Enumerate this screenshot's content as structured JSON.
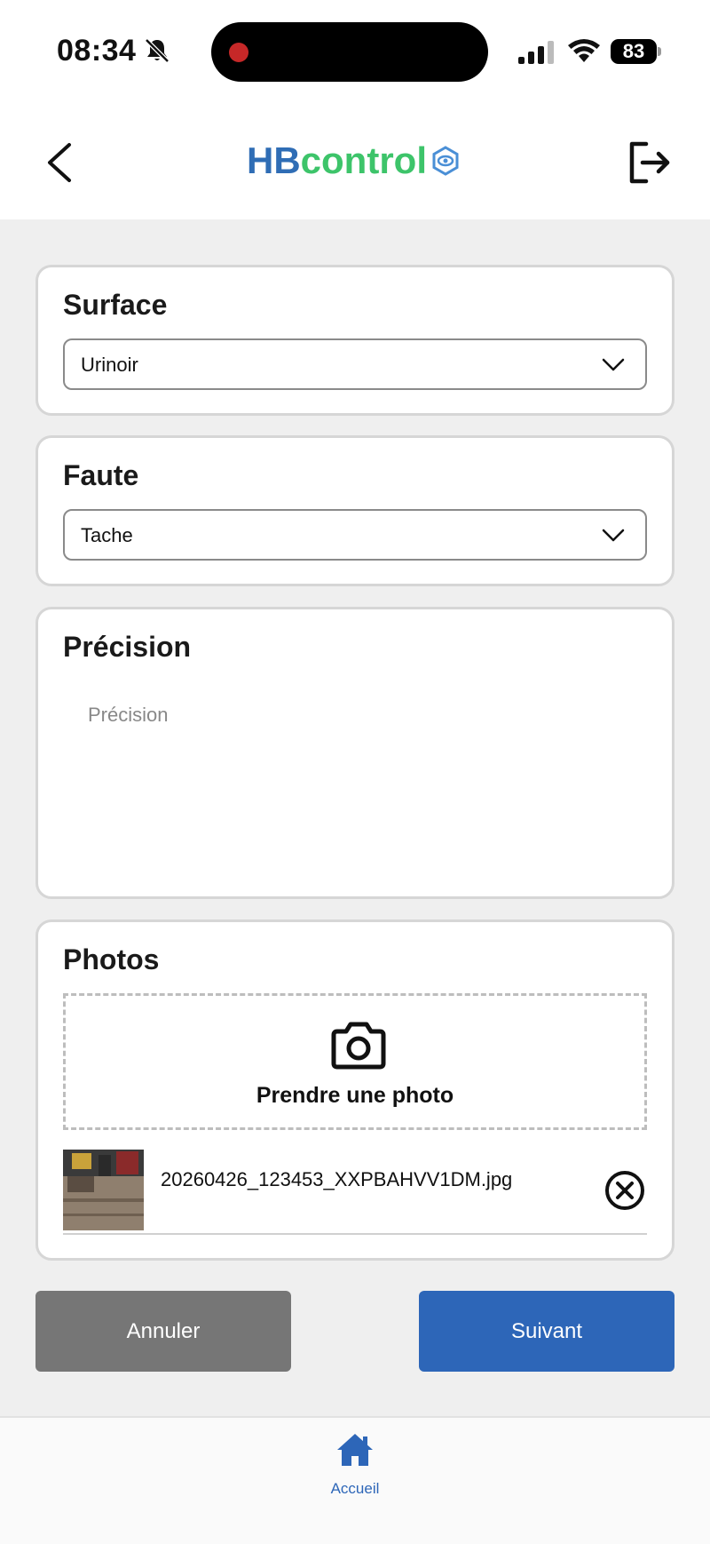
{
  "status_bar": {
    "time": "08:34",
    "battery": "83"
  },
  "header": {
    "logo_part1": "HB",
    "logo_part2": "control"
  },
  "surface": {
    "title": "Surface",
    "value": "Urinoir"
  },
  "faute": {
    "title": "Faute",
    "value": "Tache"
  },
  "precision": {
    "title": "Précision",
    "placeholder": "Précision"
  },
  "photos": {
    "title": "Photos",
    "take_photo_label": "Prendre une photo",
    "files": [
      {
        "name": "20260426_123453_XXPBAHVV1DM.jpg"
      }
    ]
  },
  "actions": {
    "cancel_label": "Annuler",
    "next_label": "Suivant"
  },
  "nav": {
    "home_label": "Accueil"
  },
  "colors": {
    "brand_blue": "#2d66b8",
    "brand_green": "#3dc46a",
    "cancel_gray": "#767676"
  }
}
